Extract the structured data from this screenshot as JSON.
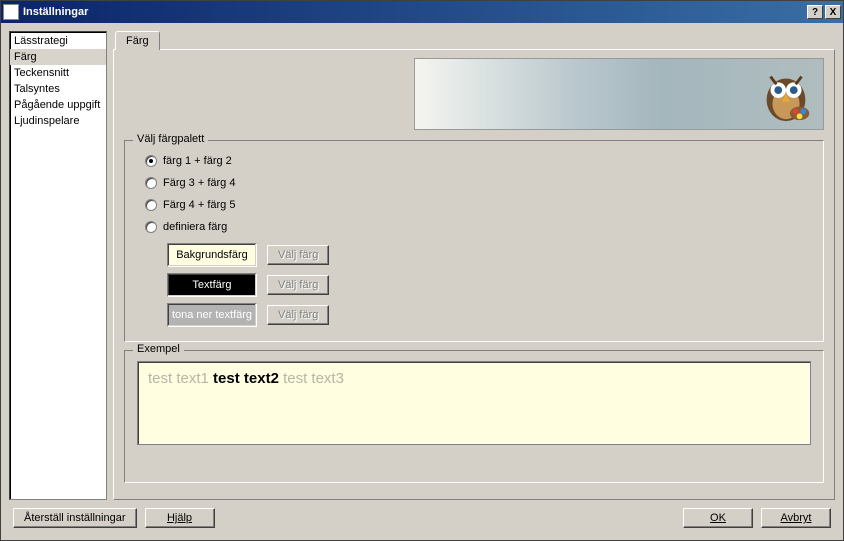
{
  "title": "Inställningar",
  "titlebar": {
    "help": "?",
    "close": "X"
  },
  "sidebar": {
    "items": [
      {
        "label": "Lässtrategi"
      },
      {
        "label": "Färg"
      },
      {
        "label": "Teckensnitt"
      },
      {
        "label": "Talsyntes"
      },
      {
        "label": "Pågående uppgift"
      },
      {
        "label": "Ljudinspelare"
      }
    ],
    "selected": 1
  },
  "tab": {
    "label": "Färg"
  },
  "palette": {
    "legend": "Välj färgpalett",
    "options": [
      "färg 1 + färg 2",
      "Färg 3 + färg 4",
      "Färg 4 + färg 5",
      "definiera färg"
    ],
    "selected": 0,
    "rows": [
      {
        "swatch_label": "Bakgrundsfärg",
        "btn": "Välj färg"
      },
      {
        "swatch_label": "Textfärg",
        "btn": "Välj färg"
      },
      {
        "swatch_label": "tona ner textfärg",
        "btn": "Välj färg"
      }
    ]
  },
  "example": {
    "legend": "Exempel",
    "t1": "test text1 ",
    "t2": "test text2",
    "t3": " test text3"
  },
  "footer": {
    "reset": "Återställ inställningar",
    "help": "Hjälp",
    "ok": "OK",
    "cancel": "Avbryt"
  }
}
